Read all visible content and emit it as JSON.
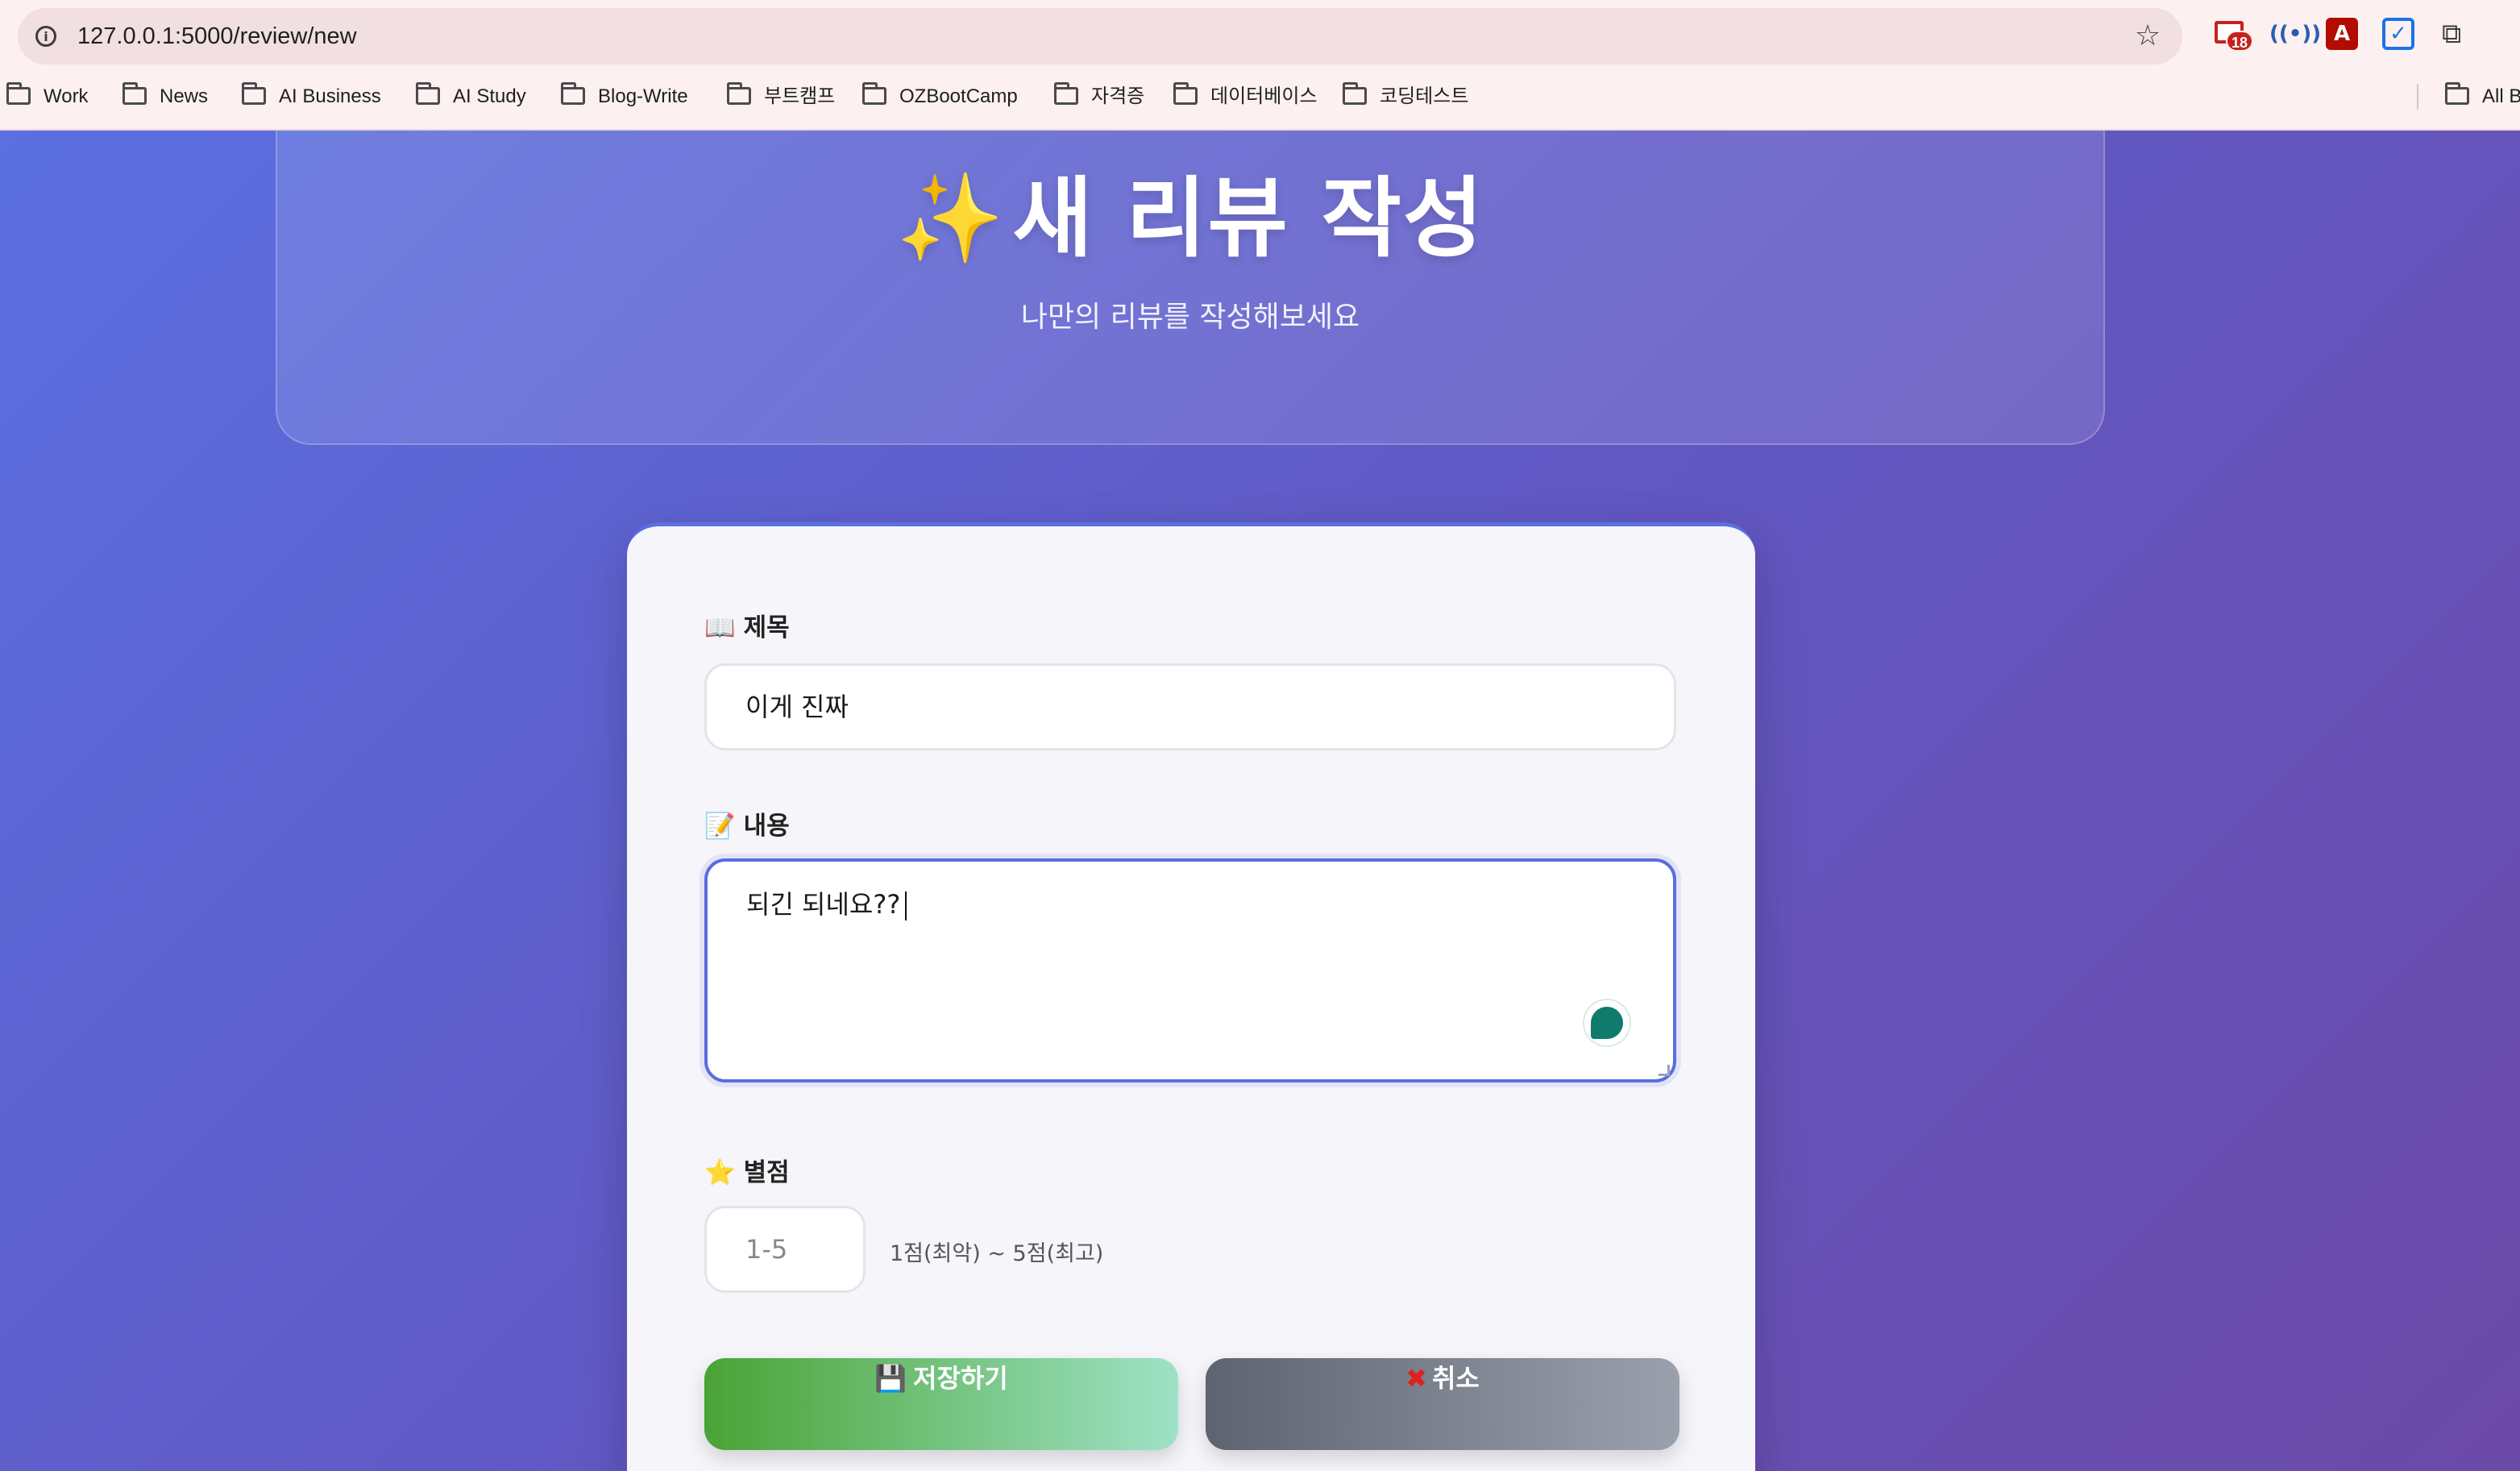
{
  "browser": {
    "url": "127.0.0.1:5000/review/new",
    "gmail_badge": "18",
    "bookmarks": [
      "Work",
      "News",
      "AI Business",
      "AI Study",
      "Blog-Write",
      "부트캠프",
      "OZBootCamp",
      "자격증",
      "데이터베이스",
      "코딩테스트"
    ],
    "all_bookmarks_label": "All B"
  },
  "header": {
    "title": "새 리뷰 작성",
    "title_icon": "sparkles-icon",
    "subtitle": "나만의 리뷰를 작성해보세요"
  },
  "form": {
    "title_label": "제목",
    "title_icon": "open-book-icon",
    "title_value": "이게 진짜",
    "content_label": "내용",
    "content_icon": "memo-icon",
    "content_value": "되긴 되네요??",
    "rating_label": "별점",
    "rating_icon": "star-icon",
    "rating_placeholder": "1-5",
    "rating_hint": "1점(최악) ~ 5점(최고)",
    "save_label": "저장하기",
    "save_icon": "floppy-disk-icon",
    "cancel_label": "취소",
    "cancel_icon": "cross-mark-icon"
  },
  "colors": {
    "background_start": "#5b6fe0",
    "background_end": "#6c4aa8",
    "save_button_start": "#4aa335",
    "save_button_end": "#9ee2c6",
    "cancel_button_start": "#5f6370",
    "cancel_button_end": "#9aa1ad",
    "focus_border": "#5a6de0"
  }
}
